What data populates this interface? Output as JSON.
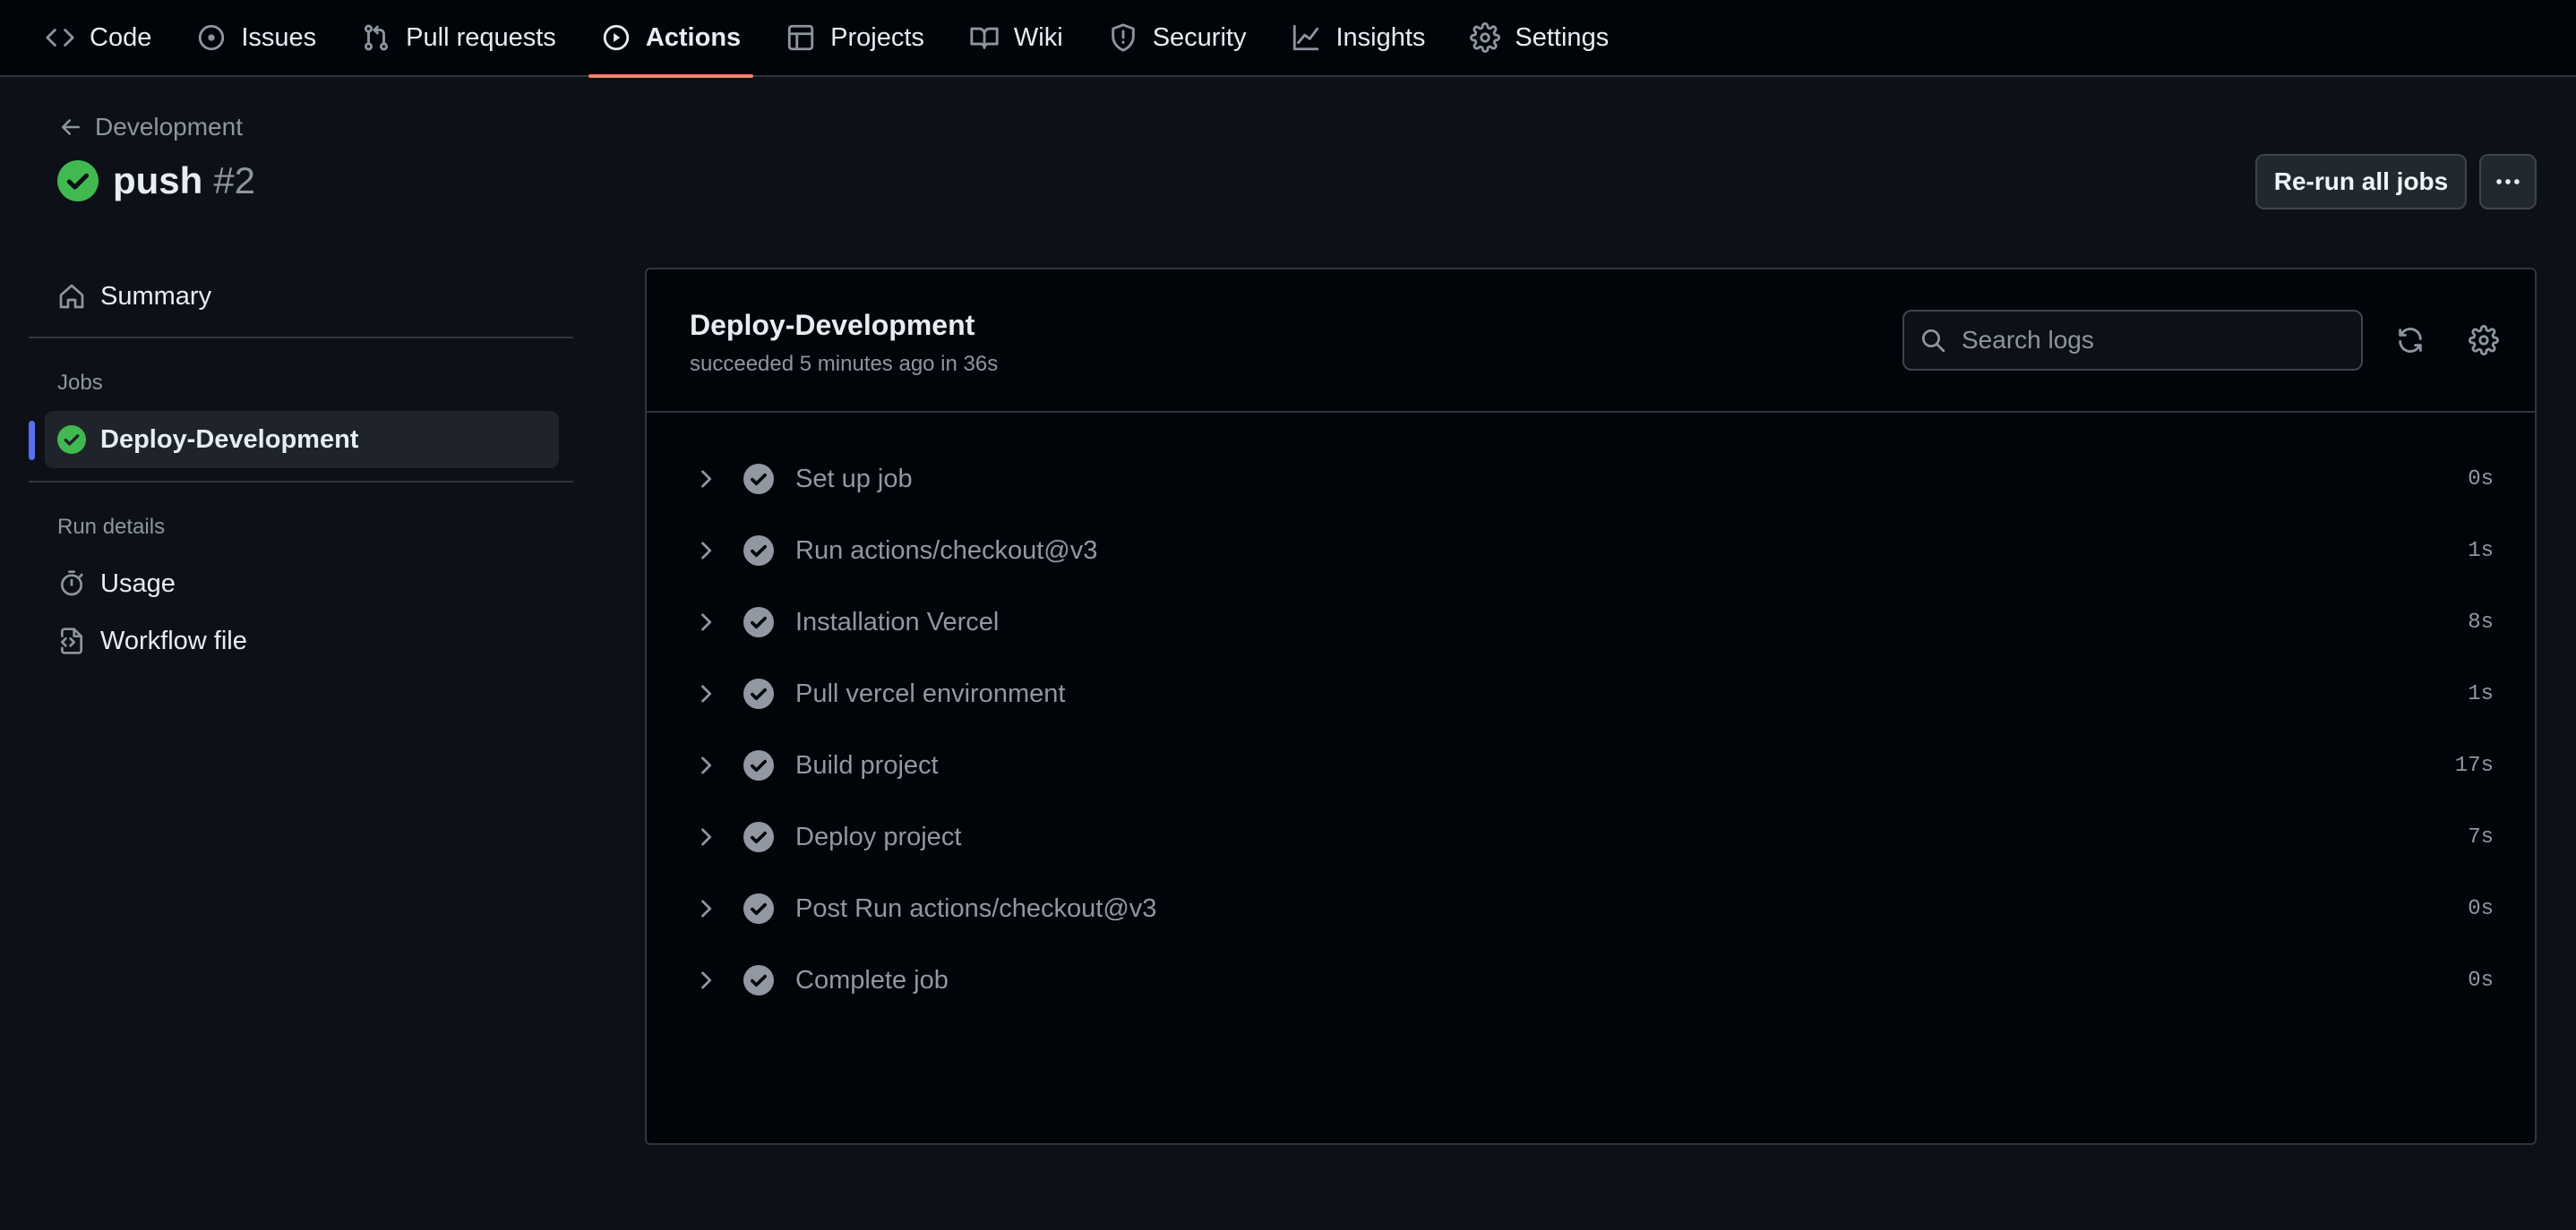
{
  "nav": {
    "tabs": [
      {
        "label": "Code",
        "icon": "code-icon"
      },
      {
        "label": "Issues",
        "icon": "issue-icon"
      },
      {
        "label": "Pull requests",
        "icon": "pull-request-icon"
      },
      {
        "label": "Actions",
        "icon": "play-icon",
        "active": true
      },
      {
        "label": "Projects",
        "icon": "table-icon"
      },
      {
        "label": "Wiki",
        "icon": "book-icon"
      },
      {
        "label": "Security",
        "icon": "shield-icon"
      },
      {
        "label": "Insights",
        "icon": "graph-icon"
      },
      {
        "label": "Settings",
        "icon": "gear-icon"
      }
    ]
  },
  "header": {
    "back_label": "Development",
    "run_event": "push",
    "run_number": "#2",
    "rerun_label": "Re-run all jobs"
  },
  "sidebar": {
    "summary_label": "Summary",
    "jobs_heading": "Jobs",
    "job_label": "Deploy-Development",
    "run_details_heading": "Run details",
    "usage_label": "Usage",
    "workflow_label": "Workflow file"
  },
  "job": {
    "title": "Deploy-Development",
    "status": "succeeded 5 minutes ago in 36s",
    "search_placeholder": "Search logs",
    "steps": [
      {
        "name": "Set up job",
        "duration": "0s"
      },
      {
        "name": "Run actions/checkout@v3",
        "duration": "1s"
      },
      {
        "name": "Installation Vercel",
        "duration": "8s"
      },
      {
        "name": "Pull vercel environment",
        "duration": "1s"
      },
      {
        "name": "Build project",
        "duration": "17s"
      },
      {
        "name": "Deploy project",
        "duration": "7s"
      },
      {
        "name": "Post Run actions/checkout@v3",
        "duration": "0s"
      },
      {
        "name": "Complete job",
        "duration": "0s"
      }
    ]
  },
  "colors": {
    "success": "#3fb950",
    "step_check": "#9198a1",
    "accent_underline": "#f78166",
    "selection_bar": "#5a6ef0"
  }
}
